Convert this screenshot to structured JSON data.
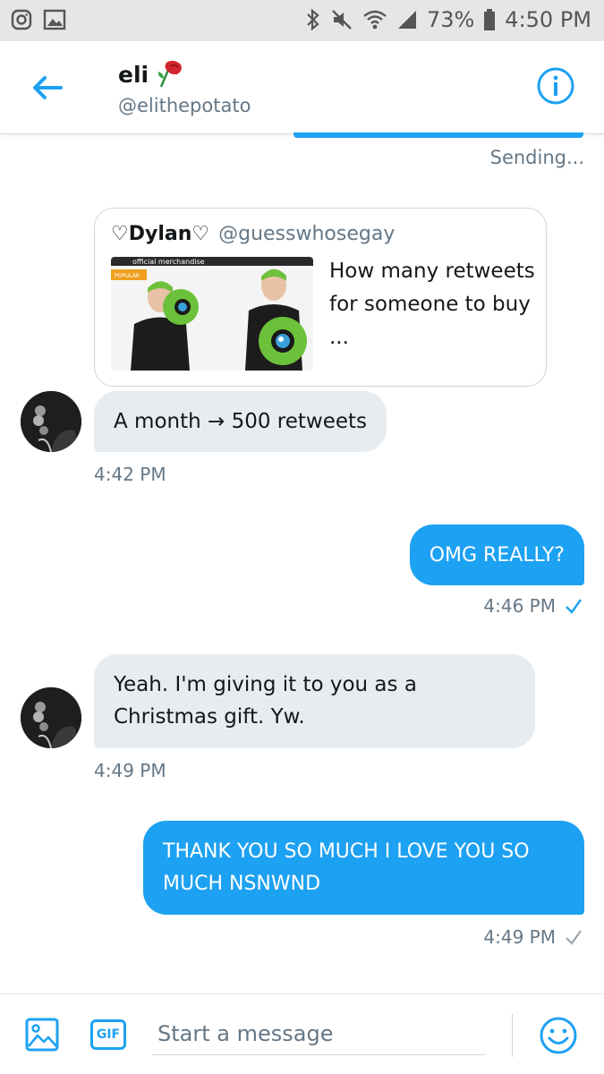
{
  "statusbar": {
    "battery": "73%",
    "time": "4:50 PM"
  },
  "header": {
    "name": "eli",
    "handle": "@elithepotato"
  },
  "sending_status": "Sending...",
  "shared_tweet": {
    "author": "♡Dylan♡",
    "handle": "@guesswhosegay",
    "text": "How many retweets for someone to buy ...",
    "image_banner": "official merchandise",
    "image_tag": "POPULAR"
  },
  "messages": [
    {
      "text": "A month → 500 retweets",
      "time": "4:42 PM"
    },
    {
      "text": "OMG REALLY?",
      "time": "4:46 PM"
    },
    {
      "text": "Yeah. I'm giving it to you as a Christmas gift. Yw.",
      "time": "4:49 PM"
    },
    {
      "text": "THANK YOU SO MUCH I LOVE YOU SO MUCH NSNWND",
      "time": "4:49 PM"
    }
  ],
  "composer": {
    "gif_label": "GIF",
    "placeholder": "Start a message"
  },
  "colors": {
    "accent": "#1da1f2",
    "incoming_bubble": "#e6ecf0",
    "muted_text": "#657786"
  }
}
